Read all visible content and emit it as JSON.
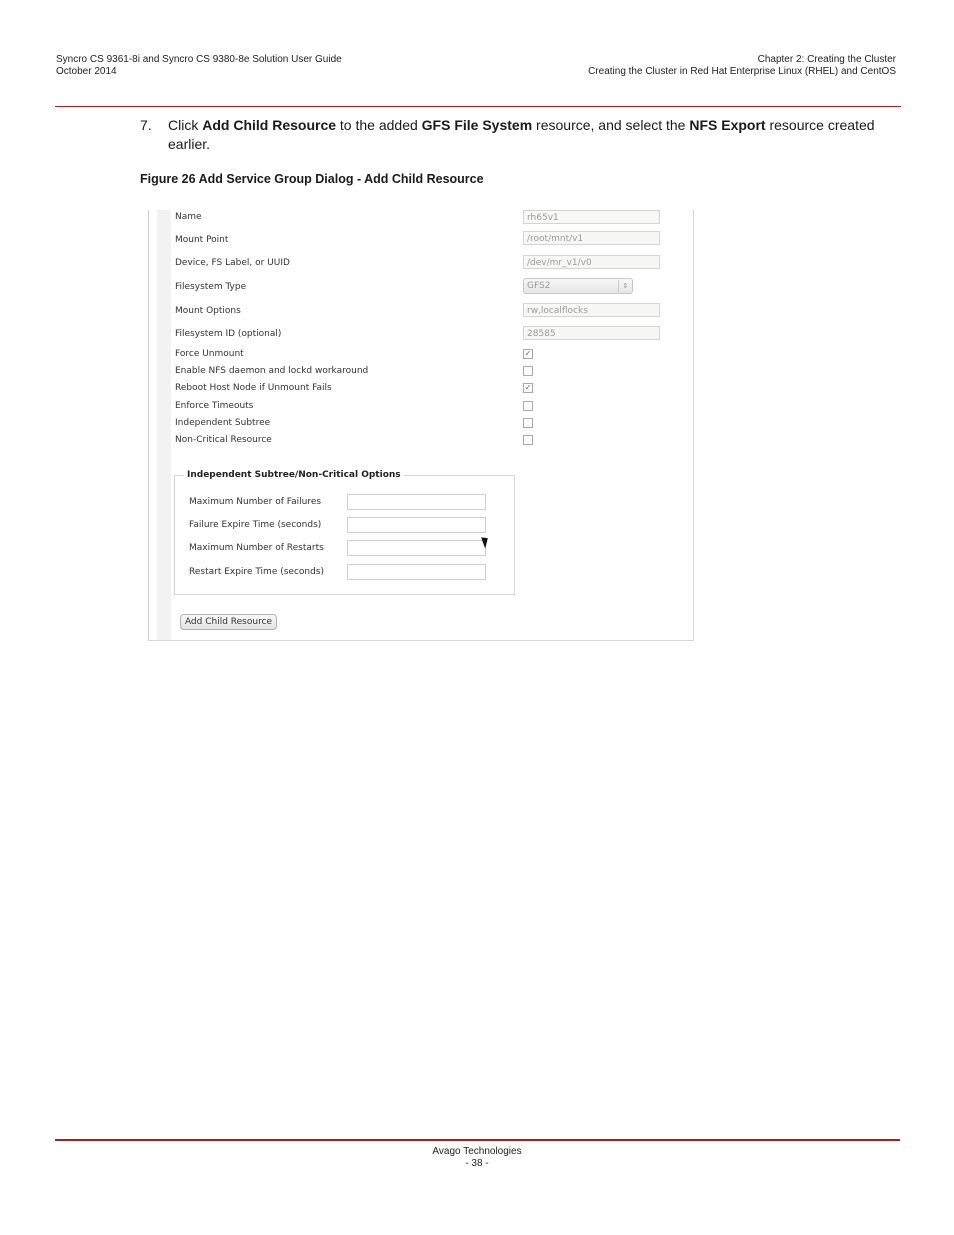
{
  "header": {
    "left_line1": "Syncro CS 9361-8i and Syncro CS 9380-8e Solution User Guide",
    "left_line2": "October 2014",
    "right_line1": "Chapter 2: Creating the Cluster",
    "right_line2": "Creating the Cluster in Red Hat Enterprise Linux (RHEL) and CentOS"
  },
  "step": {
    "number": "7.",
    "t1": "Click ",
    "b1": "Add Child Resource",
    "t2": " to the added ",
    "b2": "GFS File System",
    "t3": " resource, and select the ",
    "b3": "NFS Export",
    "t4": " resource created earlier."
  },
  "figure_caption": "Figure 26  Add Service Group Dialog - Add Child Resource",
  "dialog": {
    "fields": [
      {
        "label": "Name",
        "value": "rh65v1"
      },
      {
        "label": "Mount Point",
        "value": "/root/mnt/v1"
      },
      {
        "label": "Device, FS Label, or UUID",
        "value": "/dev/mr_v1/v0"
      },
      {
        "label": "Filesystem Type",
        "value": "GFS2"
      },
      {
        "label": "Mount Options",
        "value": "rw,localflocks"
      },
      {
        "label": "Filesystem ID (optional)",
        "value": "28585"
      }
    ],
    "checkboxes": [
      {
        "label": "Force Unmount",
        "checked": true,
        "mark": "✓"
      },
      {
        "label": "Enable NFS daemon and lockd workaround",
        "checked": false,
        "mark": ""
      },
      {
        "label": "Reboot Host Node if Unmount Fails",
        "checked": true,
        "mark": "✓"
      },
      {
        "label": "Enforce Timeouts",
        "checked": false,
        "mark": ""
      },
      {
        "label": "Independent Subtree",
        "checked": false,
        "mark": ""
      },
      {
        "label": "Non-Critical Resource",
        "checked": false,
        "mark": ""
      }
    ],
    "options_group": {
      "title": "Independent Subtree/Non-Critical Options",
      "fields": [
        {
          "label": "Maximum Number of Failures",
          "value": ""
        },
        {
          "label": "Failure Expire Time (seconds)",
          "value": ""
        },
        {
          "label": "Maximum Number of Restarts",
          "value": ""
        },
        {
          "label": "Restart Expire Time (seconds)",
          "value": ""
        }
      ]
    },
    "select_arrow_icon": "⇕",
    "add_child_button": "Add Child Resource"
  },
  "footer": {
    "company": "Avago Technologies",
    "page": "- 38 -"
  },
  "colors": {
    "rule": "#b31b1b"
  }
}
